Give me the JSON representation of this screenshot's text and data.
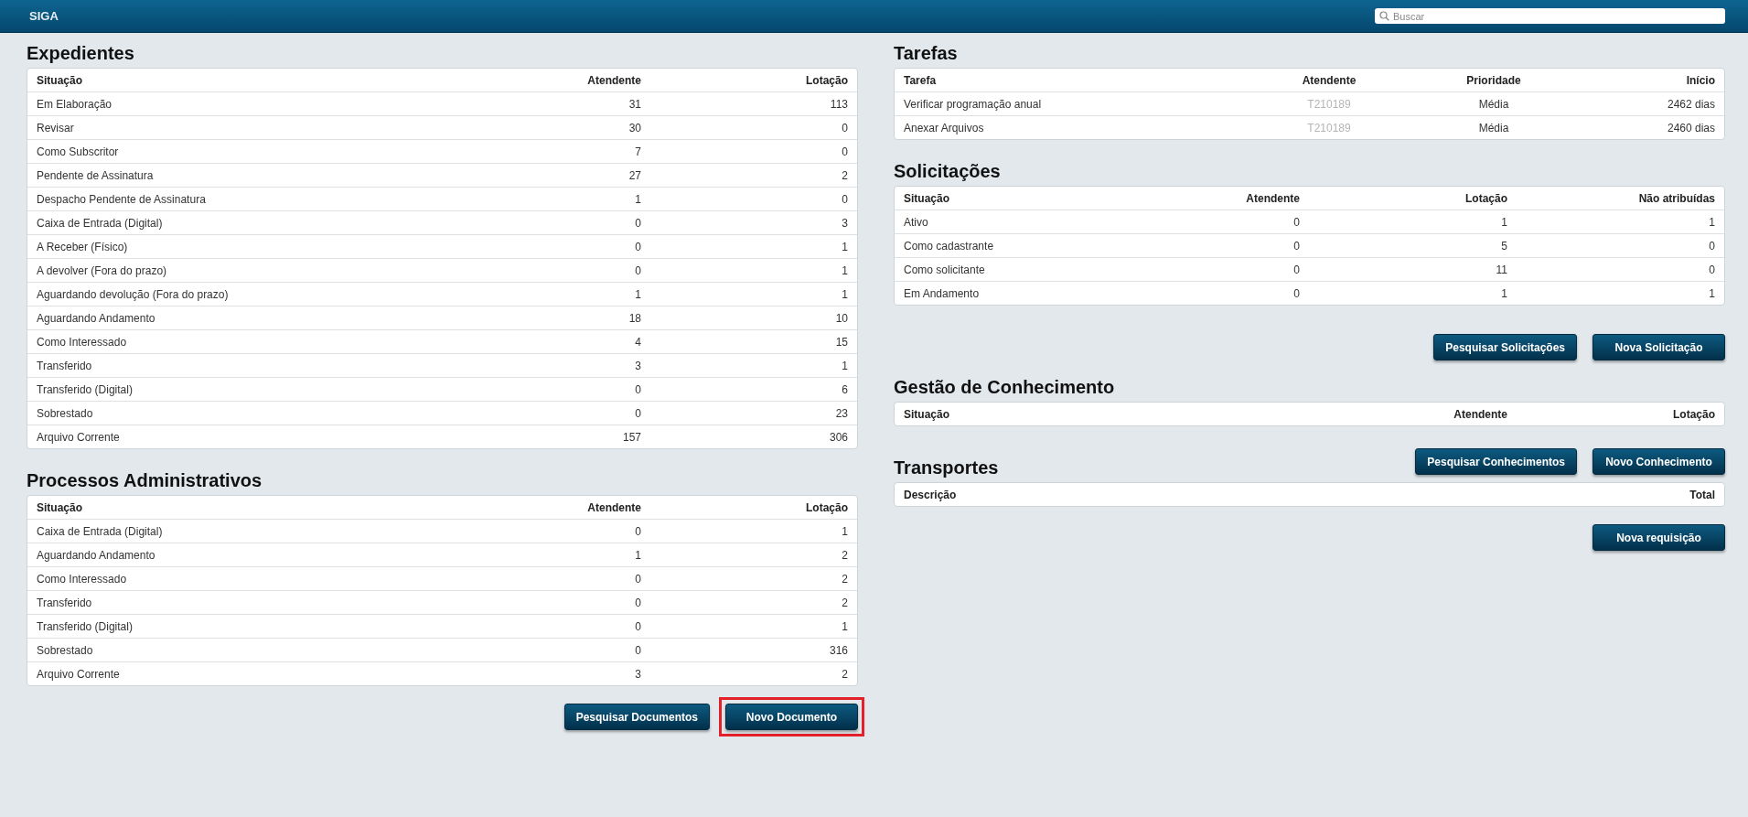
{
  "header": {
    "brand": "SIGA",
    "search": {
      "placeholder": "Buscar"
    }
  },
  "left": [
    {
      "title": "Expedientes",
      "columns": [
        {
          "label": "Situação",
          "kind": "text"
        },
        {
          "label": "Atendente",
          "kind": "number"
        },
        {
          "label": "Lotação",
          "kind": "number"
        }
      ],
      "rows": [
        [
          "Em Elaboração",
          "31",
          "113"
        ],
        [
          "Revisar",
          "30",
          "0"
        ],
        [
          "Como Subscritor",
          "7",
          "0"
        ],
        [
          "Pendente de Assinatura",
          "27",
          "2"
        ],
        [
          "Despacho Pendente de Assinatura",
          "1",
          "0"
        ],
        [
          "Caixa de Entrada (Digital)",
          "0",
          "3"
        ],
        [
          "A Receber (Físico)",
          "0",
          "1"
        ],
        [
          "A devolver (Fora do prazo)",
          "0",
          "1"
        ],
        [
          "Aguardando devolução (Fora do prazo)",
          "1",
          "1"
        ],
        [
          "Aguardando Andamento",
          "18",
          "10"
        ],
        [
          "Como Interessado",
          "4",
          "15"
        ],
        [
          "Transferido",
          "3",
          "1"
        ],
        [
          "Transferido (Digital)",
          "0",
          "6"
        ],
        [
          "Sobrestado",
          "0",
          "23"
        ],
        [
          "Arquivo Corrente",
          "157",
          "306"
        ]
      ]
    },
    {
      "title": "Processos Administrativos",
      "columns": [
        {
          "label": "Situação",
          "kind": "text"
        },
        {
          "label": "Atendente",
          "kind": "number"
        },
        {
          "label": "Lotação",
          "kind": "number"
        }
      ],
      "rows": [
        [
          "Caixa de Entrada (Digital)",
          "0",
          "1"
        ],
        [
          "Aguardando Andamento",
          "1",
          "2"
        ],
        [
          "Como Interessado",
          "0",
          "2"
        ],
        [
          "Transferido",
          "0",
          "2"
        ],
        [
          "Transferido (Digital)",
          "0",
          "1"
        ],
        [
          "Sobrestado",
          "0",
          "316"
        ],
        [
          "Arquivo Corrente",
          "3",
          "2"
        ]
      ],
      "buttons": [
        {
          "label": "Pesquisar Documentos",
          "highlighted": false
        },
        {
          "label": "Novo Documento",
          "highlighted": true
        }
      ]
    }
  ],
  "right": [
    {
      "title": "Tarefas",
      "columns": [
        {
          "label": "Tarefa",
          "kind": "text"
        },
        {
          "label": "Atendente",
          "kind": "muted"
        },
        {
          "label": "Prioridade",
          "kind": "center"
        },
        {
          "label": "Início",
          "kind": "number"
        }
      ],
      "rows": [
        [
          "Verificar programação anual",
          "T210189",
          "Média",
          "2462 dias"
        ],
        [
          "Anexar Arquivos",
          "T210189",
          "Média",
          "2460 dias"
        ]
      ]
    },
    {
      "title": "Solicitações",
      "columns": [
        {
          "label": "Situação",
          "kind": "text"
        },
        {
          "label": "Atendente",
          "kind": "number"
        },
        {
          "label": "Lotação",
          "kind": "number"
        },
        {
          "label": "Não atribuídas",
          "kind": "number"
        }
      ],
      "rows": [
        [
          "Ativo",
          "0",
          "1",
          "1"
        ],
        [
          "Como cadastrante",
          "0",
          "5",
          "0"
        ],
        [
          "Como solicitante",
          "0",
          "11",
          "0"
        ],
        [
          "Em Andamento",
          "0",
          "1",
          "1"
        ]
      ],
      "buttons": [
        {
          "label": "Pesquisar Solicitações",
          "highlighted": false
        },
        {
          "label": "Nova Solicitação",
          "highlighted": false
        }
      ]
    },
    {
      "title": "Gestão de Conhecimento",
      "columns": [
        {
          "label": "Situação",
          "kind": "text"
        },
        {
          "label": "Atendente",
          "kind": "number"
        },
        {
          "label": "Lotação",
          "kind": "number"
        }
      ],
      "buttons": [
        {
          "label": "Pesquisar Conhecimentos",
          "highlighted": false
        },
        {
          "label": "Novo Conhecimento",
          "highlighted": false
        }
      ]
    },
    {
      "title": "Transportes",
      "columns": [
        {
          "label": "Descrição",
          "kind": "text"
        },
        {
          "label": "Total",
          "kind": "number"
        }
      ],
      "buttons": [
        {
          "label": "Nova requisição",
          "highlighted": false
        }
      ]
    }
  ]
}
